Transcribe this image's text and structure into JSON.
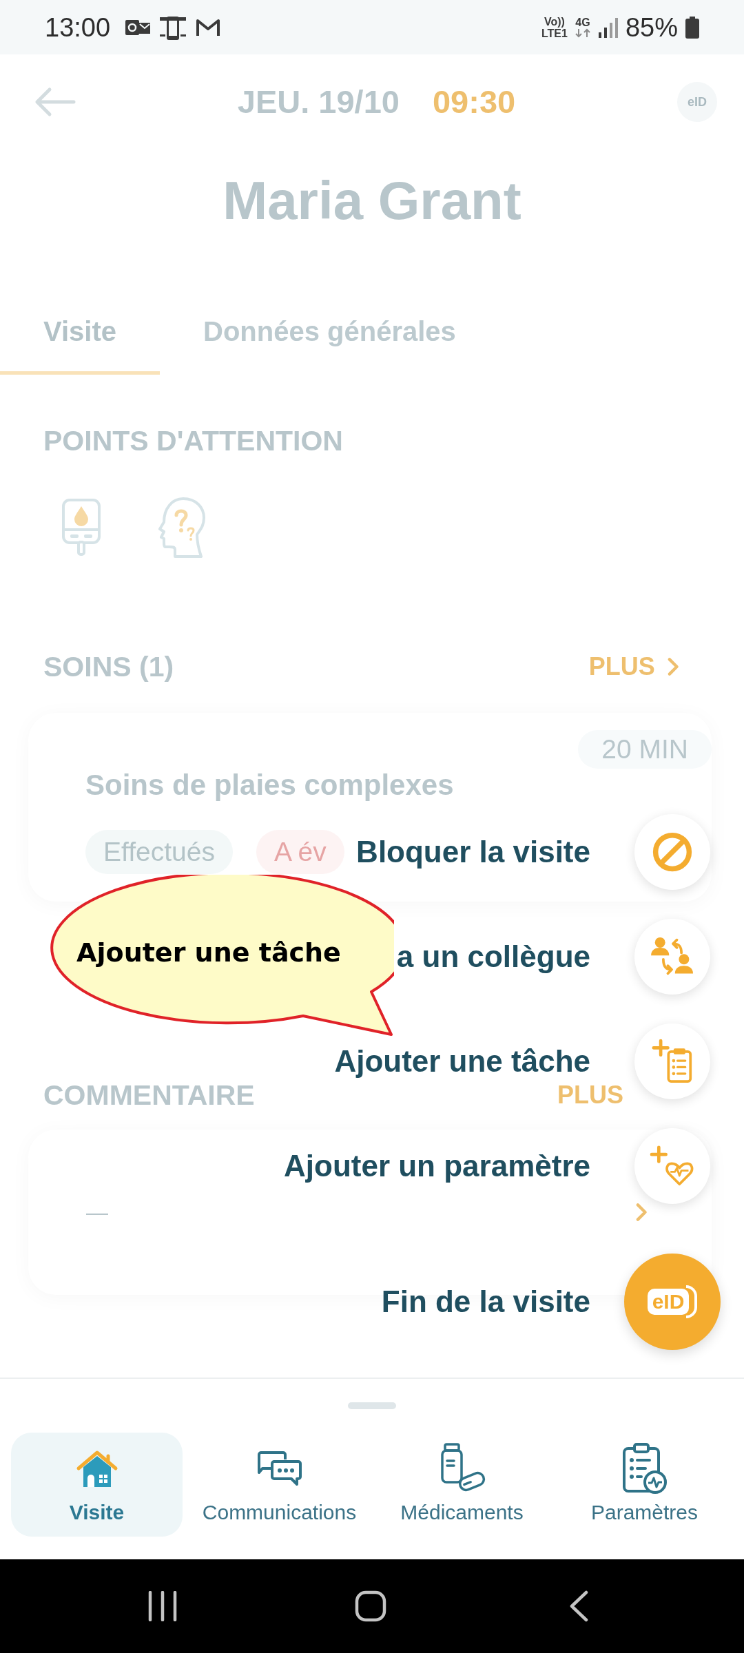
{
  "status_bar": {
    "time": "13:00",
    "volte": "Vo))",
    "volte_line": "LTE1",
    "network": "4G",
    "battery": "85%"
  },
  "header": {
    "date": "JEU. 19/10",
    "time": "09:30",
    "badge": "eID",
    "patient": "Maria Grant"
  },
  "tabs": [
    {
      "label": "Visite",
      "selected": true
    },
    {
      "label": "Données générales",
      "selected": false
    }
  ],
  "attention": {
    "title": "POINTS D'ATTENTION"
  },
  "care": {
    "title": "SOINS (1)",
    "more": "PLUS",
    "items": [
      {
        "duration": "20 MIN",
        "title": "Soins de plaies complexes",
        "chips": [
          {
            "label": "Effectués",
            "kind": "done"
          },
          {
            "label": "A év",
            "kind": "pending"
          }
        ]
      }
    ]
  },
  "comment": {
    "title": "COMMENTAIRE",
    "more": "PLUS",
    "text": "—"
  },
  "callout": {
    "text": "Ajouter une tâche"
  },
  "fab_menu": {
    "items": [
      {
        "label": "Bloquer la visite",
        "kind": "block"
      },
      {
        "label": "a un collègue",
        "kind": "transfer"
      },
      {
        "label": "Ajouter une tâche",
        "kind": "task"
      },
      {
        "label": "Ajouter un paramètre",
        "kind": "parameter"
      }
    ],
    "main": {
      "label": "Fin de la visite",
      "badge": "eID"
    }
  },
  "bottom_nav": [
    {
      "label": "Visite",
      "kind": "visit",
      "selected": true
    },
    {
      "label": "Communications",
      "kind": "chat",
      "selected": false
    },
    {
      "label": "Médicaments",
      "kind": "meds",
      "selected": false
    },
    {
      "label": "Paramètres",
      "kind": "params",
      "selected": false
    }
  ]
}
